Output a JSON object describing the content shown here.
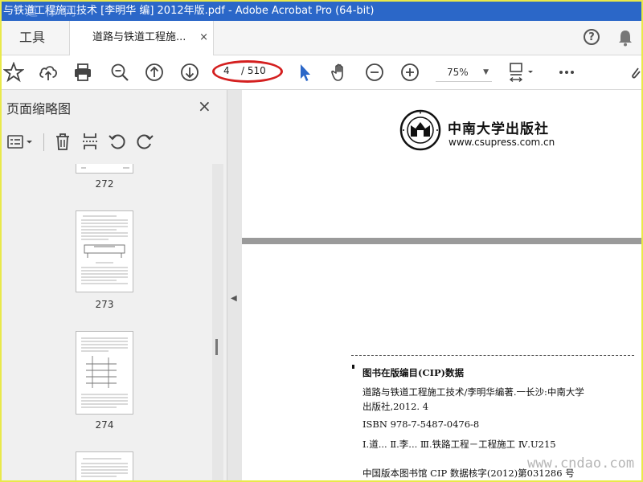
{
  "window": {
    "title": "与铁道工程施工技术 [李明华 编] 2012年版.pdf - Adobe Acrobat Pro (64-bit)",
    "watermark_overlay": "道 标 网"
  },
  "tabs": {
    "tools_label": "工具",
    "document_label": "道路与铁道工程施...",
    "close_glyph": "×"
  },
  "header_icons": {
    "help": "help-icon",
    "notifications": "bell-icon",
    "help_glyph": "?"
  },
  "toolbar": {
    "current_page": "4",
    "total_pages": "/ 510",
    "zoom": "75%",
    "icons": [
      "star-icon",
      "cloud-upload-icon",
      "print-icon",
      "zoom-out-search-icon",
      "page-up-icon",
      "page-down-icon",
      "select-cursor-icon",
      "hand-icon",
      "zoom-out-icon",
      "zoom-in-icon",
      "fit-page-icon",
      "more-icon",
      "sign-icon"
    ],
    "highlight_color": "#d42020"
  },
  "sidepanel": {
    "title": "页面缩略图",
    "close_glyph": "×",
    "tool_icons": [
      "options-menu-icon",
      "delete-icon",
      "insert-page-icon",
      "rotate-ccw-icon",
      "rotate-cw-icon"
    ],
    "thumbnails": [
      {
        "label": "272"
      },
      {
        "label": "273"
      },
      {
        "label": "274"
      },
      {
        "label": ""
      }
    ]
  },
  "document": {
    "press_name": "中南大学出版社",
    "press_url": "www.csupress.com.cn",
    "cip_heading": "图书在版编目(CIP)数据",
    "cip_line1": "道路与铁道工程施工技术/李明华编著.一长沙:中南大学",
    "cip_line2": "出版社,2012. 4",
    "isbn": "ISBN 978-7-5487-0476-8",
    "classification": "Ⅰ.道...   Ⅱ.李...   Ⅲ.铁路工程－工程施工   Ⅳ.U215",
    "cip_number": "中国版本图书馆 CIP 数据核字(2012)第031286 号",
    "site_watermark": "www.cndao.com"
  },
  "colors": {
    "titlebar": "#2b67c8",
    "border": "#e9e94a",
    "accent_cursor": "#2b67c8"
  }
}
